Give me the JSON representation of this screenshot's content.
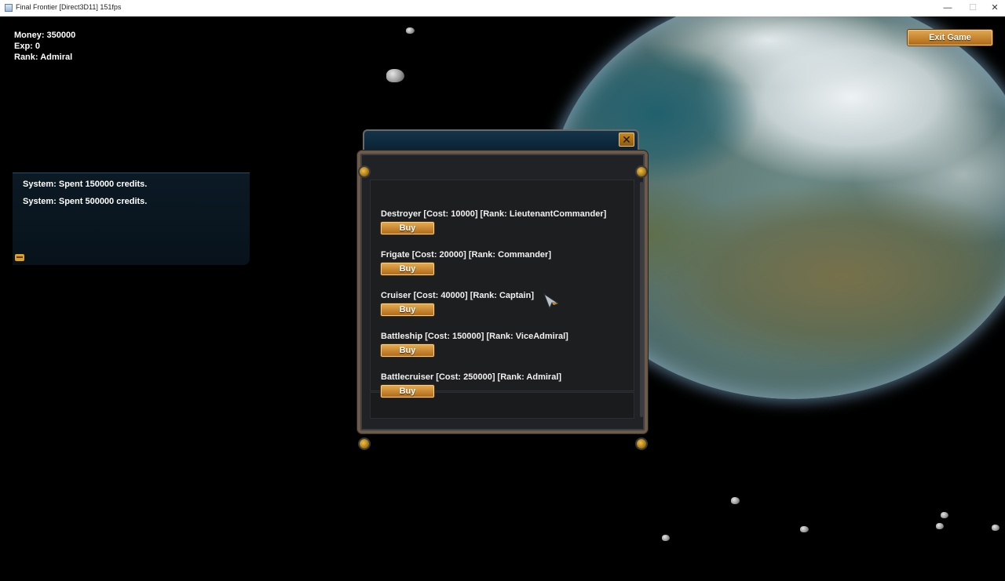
{
  "window": {
    "title": "Final Frontier [Direct3D11] 151fps",
    "minimize_glyph": "—",
    "maximize_glyph": "☐",
    "close_glyph": "✕"
  },
  "hud": {
    "money": "Money: 350000",
    "exp": "Exp: 0",
    "rank": "Rank: Admiral",
    "exit_label": "Exit Game"
  },
  "chat": {
    "messages": [
      "System: Spent 150000 credits.",
      "System: Spent 500000 credits."
    ],
    "icon": "chat-bubble-icon"
  },
  "shop": {
    "close_glyph": "✕",
    "items": [
      {
        "label": "Destroyer [Cost: 10000] [Rank: LieutenantCommander]",
        "buy_label": "Buy"
      },
      {
        "label": "Frigate [Cost: 20000] [Rank: Commander]",
        "buy_label": "Buy"
      },
      {
        "label": "Cruiser [Cost: 40000] [Rank: Captain]",
        "buy_label": "Buy"
      },
      {
        "label": "Battleship [Cost: 150000] [Rank: ViceAdmiral]",
        "buy_label": "Buy"
      },
      {
        "label": "Battlecruiser [Cost: 250000] [Rank: Admiral]",
        "buy_label": "Buy"
      }
    ]
  },
  "colors": {
    "accent_gold": "#d08f30",
    "panel_dark": "#202226",
    "header_blue": "#14344a"
  }
}
